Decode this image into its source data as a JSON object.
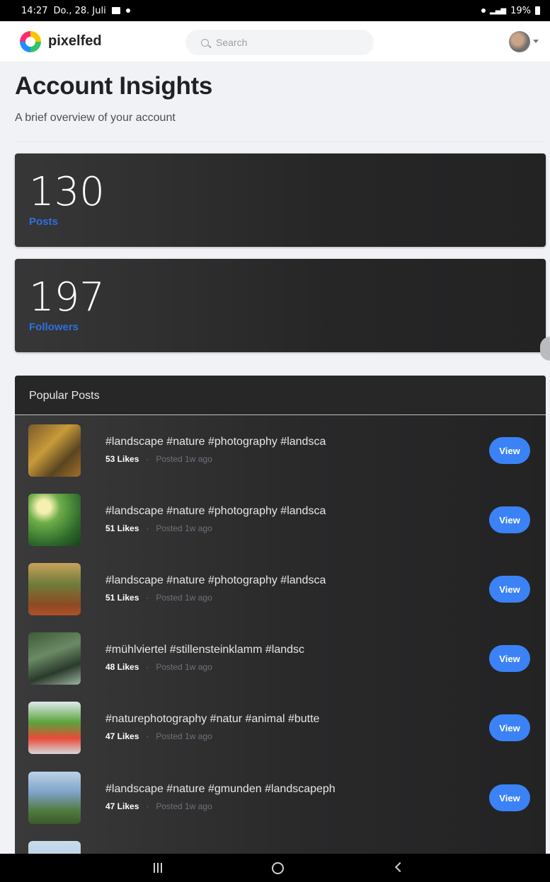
{
  "status_bar": {
    "time": "14:27",
    "date": "Do., 28. Juli",
    "battery": "19%"
  },
  "header": {
    "brand": "pixelfed",
    "search_placeholder": "Search"
  },
  "page": {
    "title": "Account Insights",
    "subtitle": "A brief overview of your account"
  },
  "stats": {
    "posts": {
      "value": "130",
      "label": "Posts"
    },
    "followers": {
      "value": "197",
      "label": "Followers"
    }
  },
  "popular": {
    "title": "Popular Posts",
    "view_label": "View",
    "posts": [
      {
        "caption": "#landscape #nature #photography #landsca",
        "likes": "53 Likes",
        "posted": "Posted 1w ago"
      },
      {
        "caption": "#landscape #nature #photography #landsca",
        "likes": "51 Likes",
        "posted": "Posted 1w ago"
      },
      {
        "caption": "#landscape #nature #photography #landsca",
        "likes": "51 Likes",
        "posted": "Posted 1w ago"
      },
      {
        "caption": "#mühlviertel #stillensteinklamm #landsc",
        "likes": "48 Likes",
        "posted": "Posted 1w ago"
      },
      {
        "caption": "#naturephotography #natur #animal #butte",
        "likes": "47 Likes",
        "posted": "Posted 1w ago"
      },
      {
        "caption": "#landscape #nature #gmunden #landscapeph",
        "likes": "47 Likes",
        "posted": "Posted 1w ago"
      }
    ]
  },
  "colors": {
    "accent": "#3b82f6",
    "card_bg": "#262627",
    "page_bg": "#f1f2f5"
  }
}
